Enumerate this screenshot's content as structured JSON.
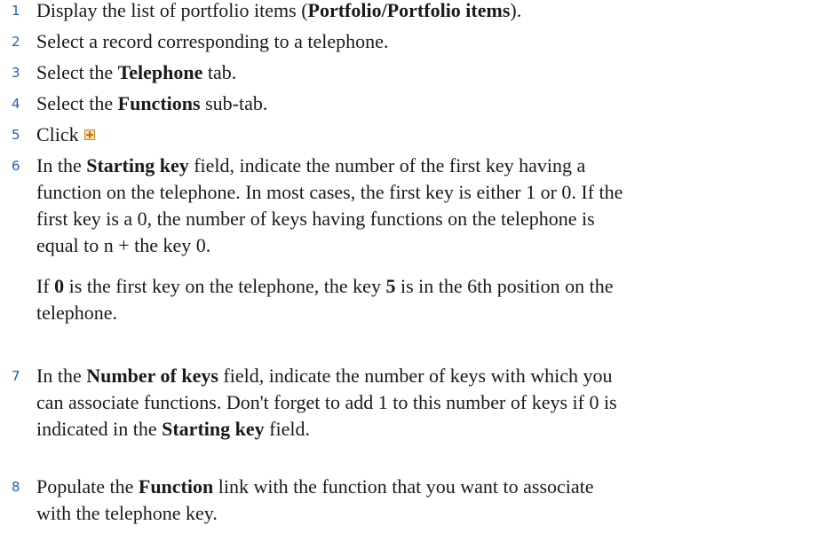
{
  "steps": [
    {
      "number": "1",
      "before": "Display the list of portfolio items (",
      "bold": "Portfolio/Portfolio items",
      "after": ")."
    },
    {
      "number": "2",
      "text": "Select a record corresponding to a telephone."
    },
    {
      "number": "3",
      "before": "Select the ",
      "bold": "Telephone",
      "after": " tab."
    },
    {
      "number": "4",
      "before": "Select the ",
      "bold": "Functions",
      "after": " sub-tab."
    },
    {
      "number": "5",
      "text": "Click",
      "icon": "add-plus-icon"
    },
    {
      "number": "6",
      "line1_before": "In the ",
      "line1_bold": "Starting key",
      "line1_after": " field, indicate the number of the first key having a",
      "line2": "function on the telephone. In most cases, the first key is either 1 or 0. If the",
      "line3": "first key is a 0, the number of keys having functions on the telephone is",
      "line4": "equal to n + the key 0.",
      "note_before": "If ",
      "note_bold1": "0",
      "note_mid": " is the first key on the telephone, the key ",
      "note_bold2": "5",
      "note_after": " is in the 6th position on the",
      "note_line2": "telephone."
    },
    {
      "number": "7",
      "line1_before": "In the ",
      "line1_bold": "Number of keys",
      "line1_after": " field, indicate the number of keys with which you",
      "line2": "can associate functions. Don't forget to add 1 to this number of keys if 0 is",
      "line3_before": "indicated in the ",
      "line3_bold": "Starting key",
      "line3_after": " field."
    },
    {
      "number": "8",
      "line1_before": "Populate the ",
      "line1_bold": "Function",
      "line1_after": " link with the function that you want to associate",
      "line2": "with the telephone key."
    }
  ]
}
